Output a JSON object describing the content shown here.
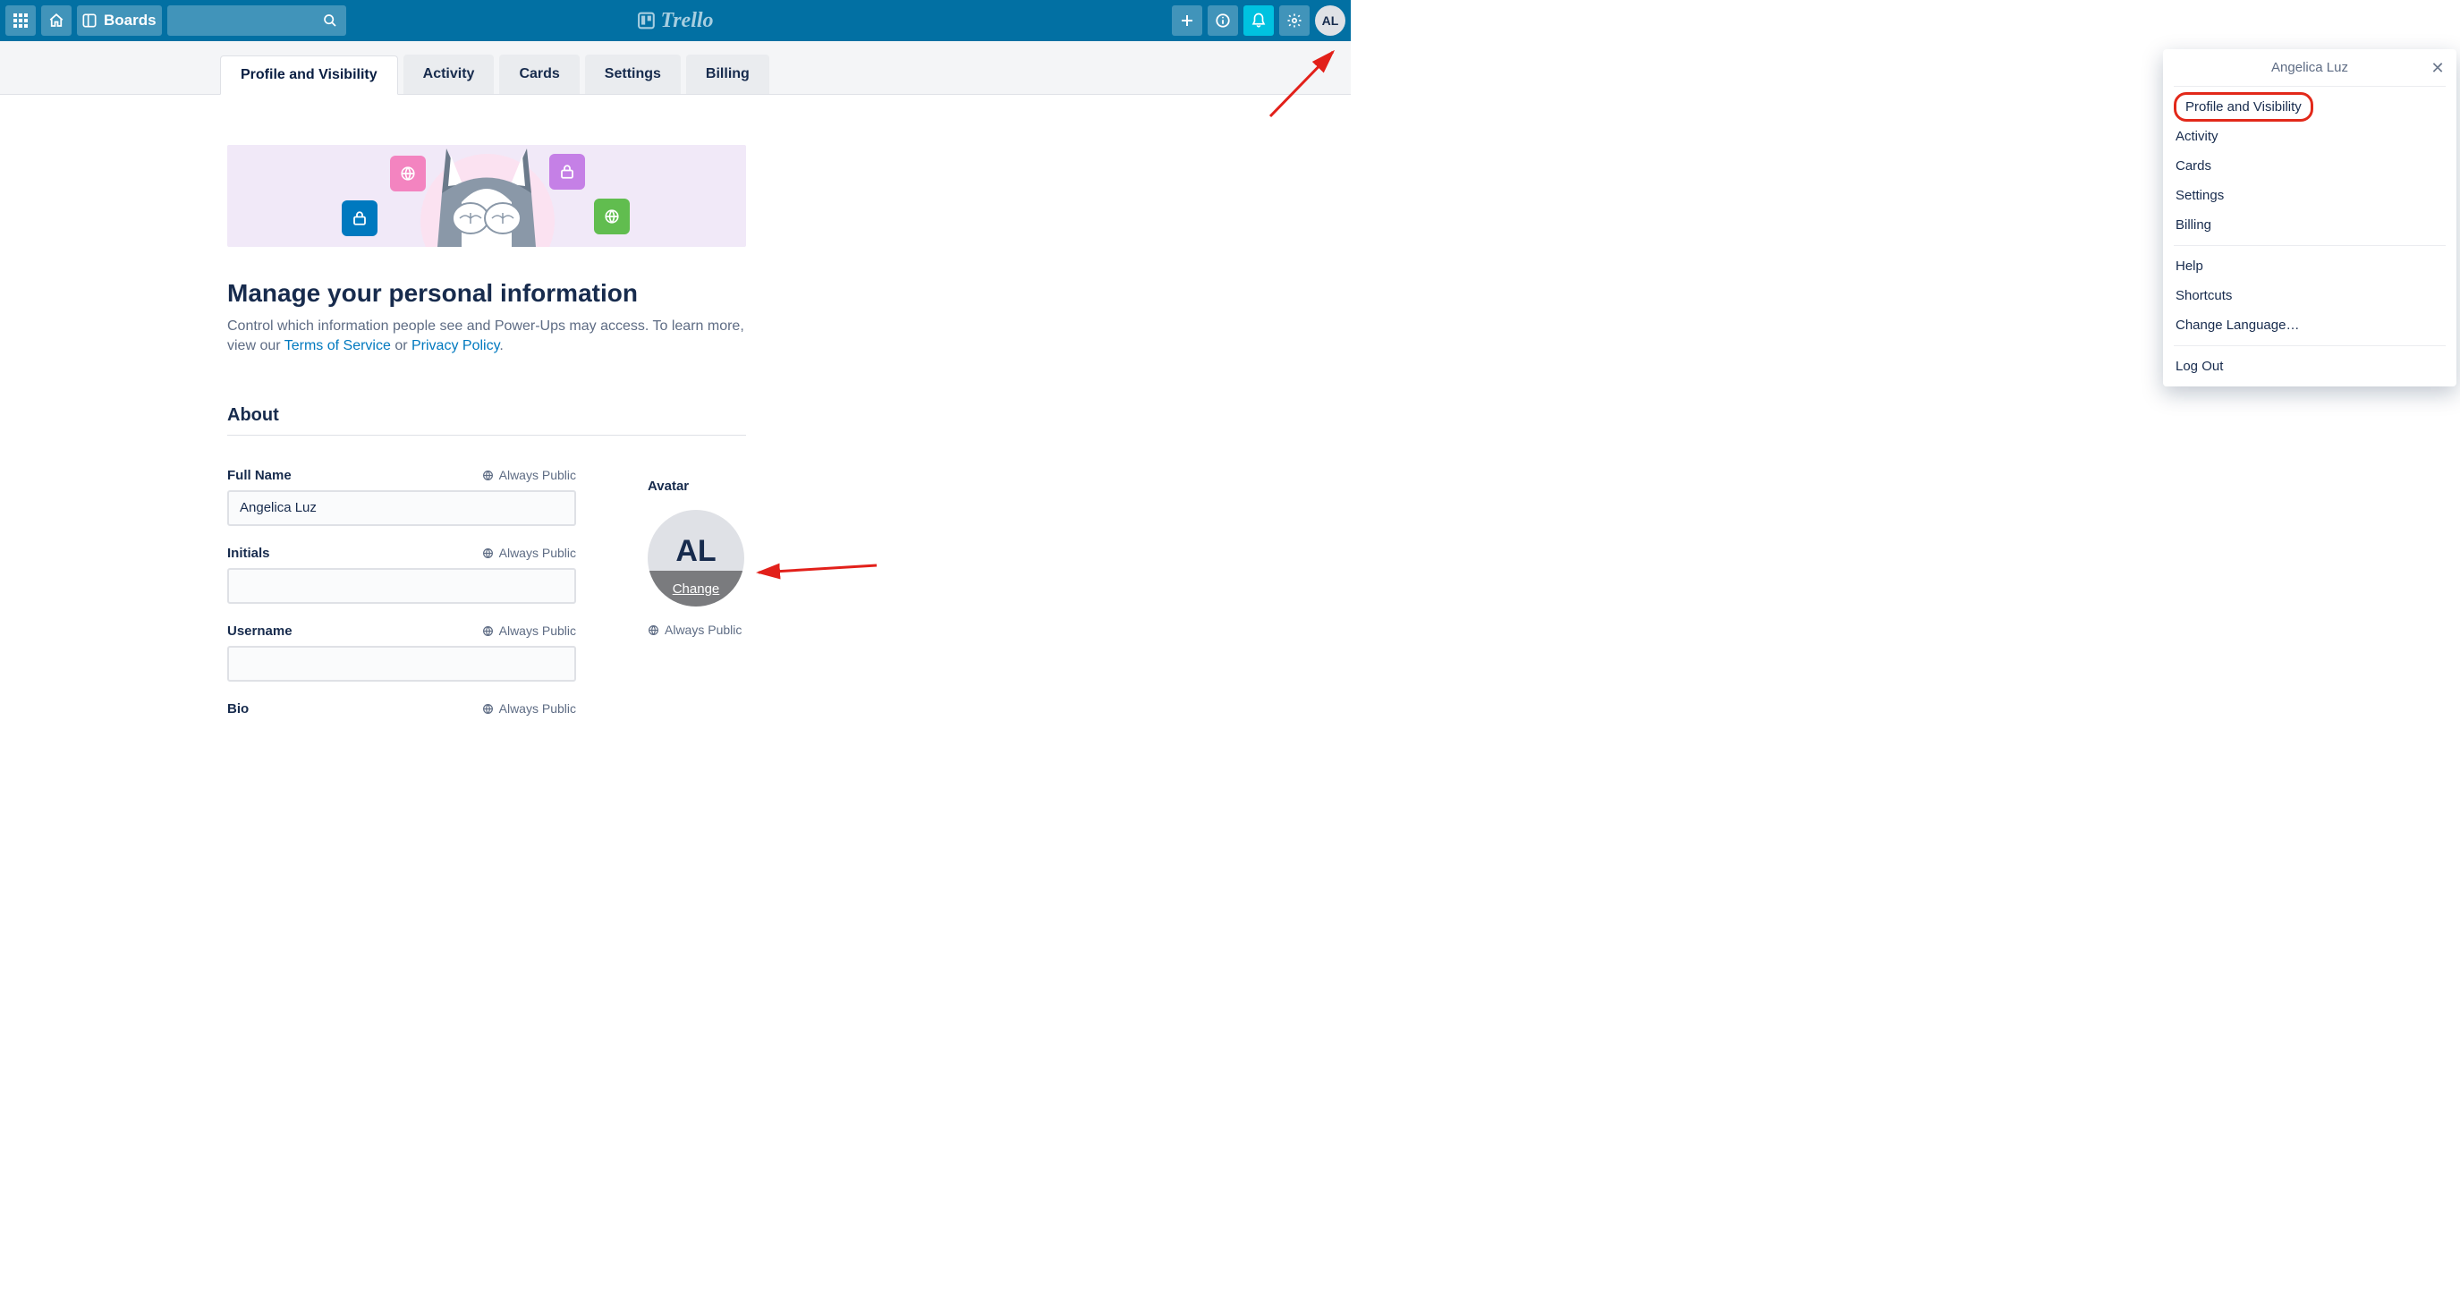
{
  "brand": "Trello",
  "header": {
    "boards_label": "Boards"
  },
  "user": {
    "name": "Angelica Luz",
    "initials": "AL"
  },
  "tabs": [
    {
      "label": "Profile and Visibility",
      "active": true
    },
    {
      "label": "Activity",
      "active": false
    },
    {
      "label": "Cards",
      "active": false
    },
    {
      "label": "Settings",
      "active": false
    },
    {
      "label": "Billing",
      "active": false
    }
  ],
  "page": {
    "title": "Manage your personal information",
    "subtitle_prefix": "Control which information people see and Power-Ups may access. To learn more, view our ",
    "tos": "Terms of Service",
    "or": " or ",
    "privacy": "Privacy Policy",
    "period": ".",
    "about_heading": "About"
  },
  "form": {
    "full_name_label": "Full Name",
    "full_name_value": "Angelica Luz",
    "initials_label": "Initials",
    "initials_value": "",
    "username_label": "Username",
    "username_value": "",
    "bio_label": "Bio",
    "public_label": "Always Public"
  },
  "avatar": {
    "label": "Avatar",
    "change": "Change",
    "public": "Always Public"
  },
  "dropdown": {
    "items_a": [
      "Profile and Visibility",
      "Activity",
      "Cards",
      "Settings",
      "Billing"
    ],
    "items_b": [
      "Help",
      "Shortcuts",
      "Change Language…"
    ],
    "items_c": [
      "Log Out"
    ]
  }
}
